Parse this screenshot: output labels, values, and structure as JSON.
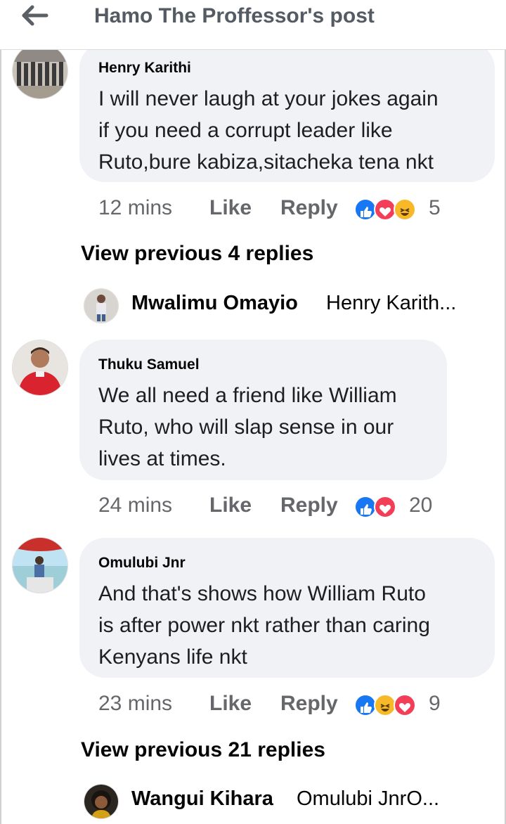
{
  "header": {
    "title": "Hamo The Proffessor's post"
  },
  "comments": [
    {
      "author": "Henry Karithi",
      "lines": [
        "I will never laugh at your jokes again",
        "if you need a corrupt leader like",
        "Ruto,bure kabiza,sitacheka tena nkt"
      ],
      "time": "12 mins",
      "like_label": "Like",
      "reply_label": "Reply",
      "reactions": [
        "like",
        "love",
        "haha"
      ],
      "reaction_count": "5"
    },
    {
      "author": "Thuku Samuel",
      "lines": [
        "We all need a friend like William",
        "Ruto, who will slap sense in our",
        "lives at times."
      ],
      "time": "24 mins",
      "like_label": "Like",
      "reply_label": "Reply",
      "reactions": [
        "like",
        "love"
      ],
      "reaction_count": "20"
    },
    {
      "author": "Omulubi Jnr",
      "lines": [
        "And that's shows how William Ruto",
        "is after power nkt rather than caring",
        "Kenyans life nkt"
      ],
      "time": "23 mins",
      "like_label": "Like",
      "reply_label": "Reply",
      "reactions": [
        "like",
        "haha",
        "love"
      ],
      "reaction_count": "9"
    }
  ],
  "view_previous": [
    "View previous 4 replies",
    "View previous 21 replies"
  ],
  "reply_previews": [
    {
      "name": "Mwalimu Omayio",
      "snippet": "Henry Karith..."
    },
    {
      "name": "Wangui Kihara",
      "snippet": "Omulubi JnrO..."
    }
  ],
  "icons": {
    "back": "back-arrow-icon",
    "like": "like-reaction-icon",
    "love": "love-reaction-icon",
    "haha": "haha-reaction-icon"
  },
  "colors": {
    "like": "#1877f2",
    "love": "#f33e58",
    "haha": "#f7b928",
    "bubble": "#f0f2f5",
    "meta": "#65676b"
  }
}
